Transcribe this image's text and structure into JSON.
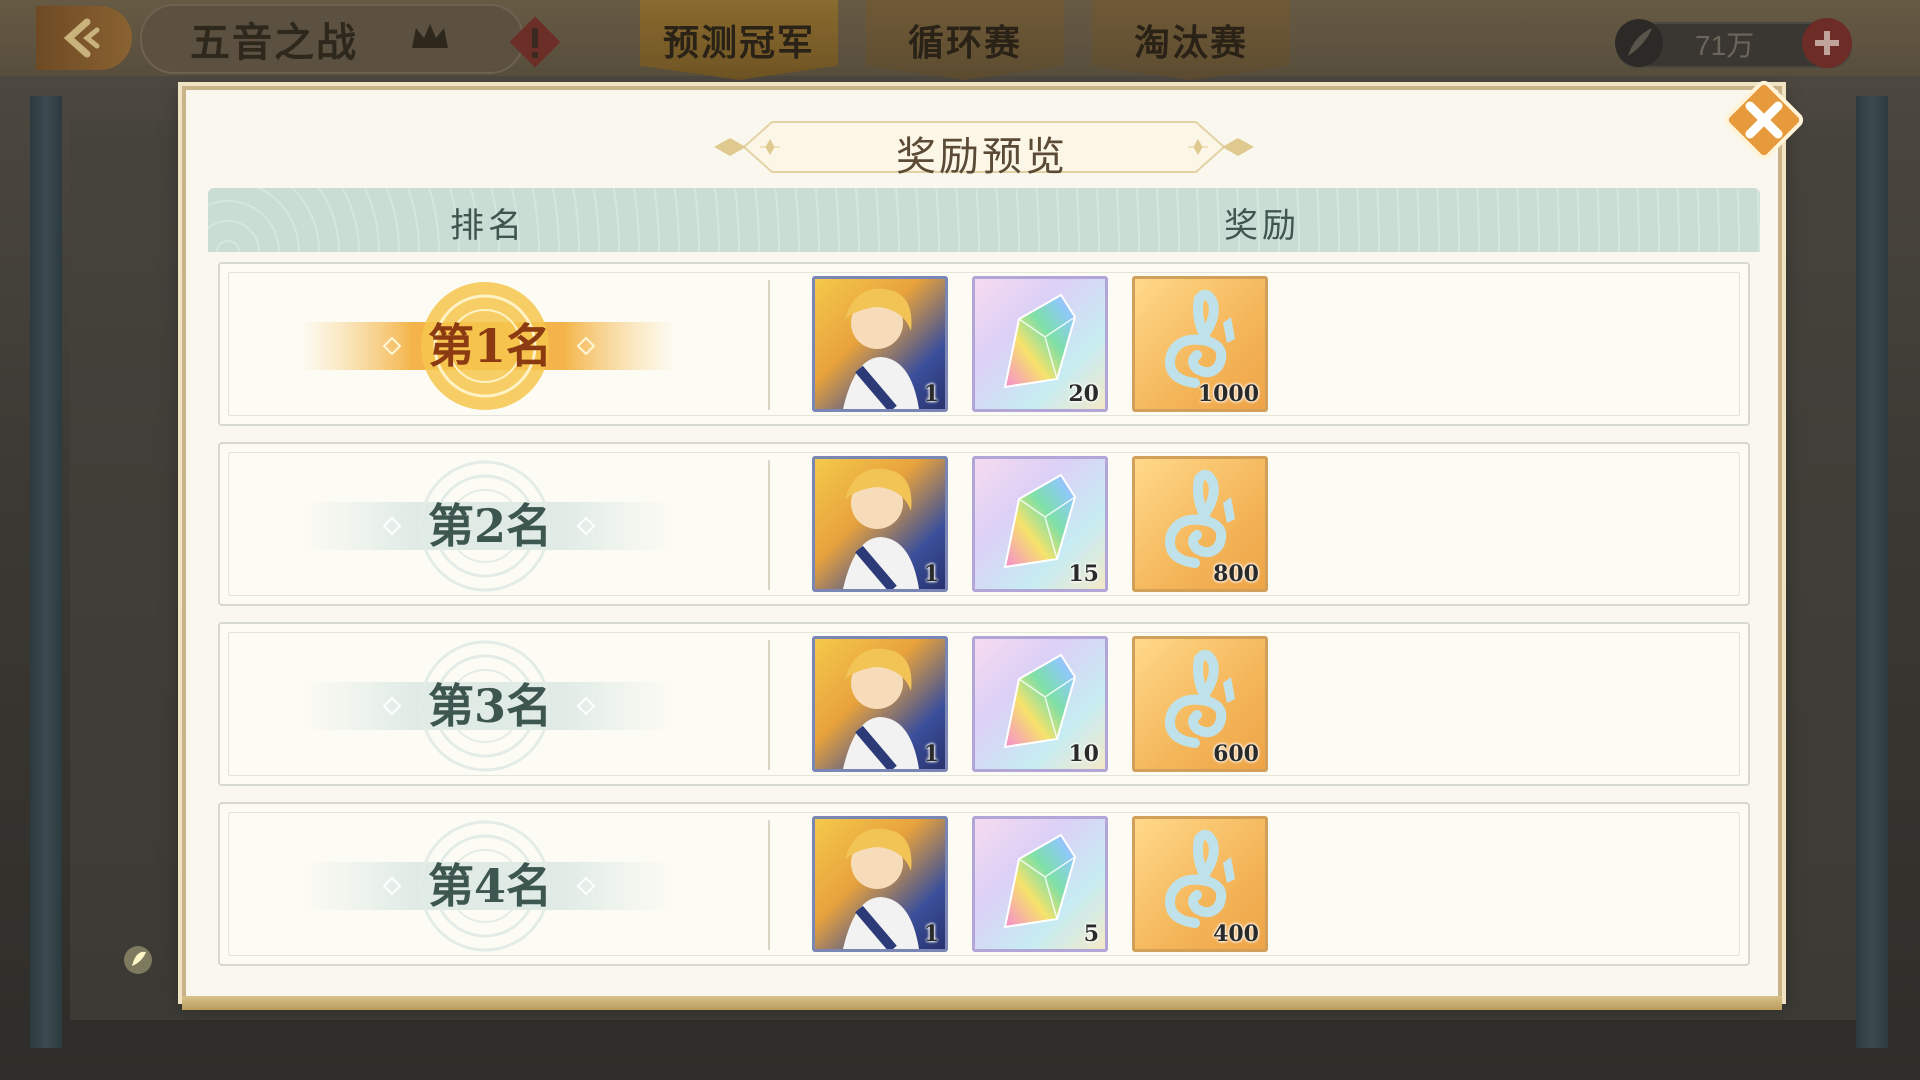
{
  "header": {
    "game_title": "五音之战",
    "tabs": [
      {
        "label": "预测冠军"
      },
      {
        "label": "循环赛"
      },
      {
        "label": "淘汰赛"
      }
    ],
    "currency_value": "71万"
  },
  "modal": {
    "title": "奖励预览",
    "columns": {
      "rank": "排名",
      "reward": "奖励"
    },
    "rows": [
      {
        "rank": "第1名",
        "rewards": [
          {
            "type": "character-card",
            "qty": "1"
          },
          {
            "type": "rainbow-crystal",
            "qty": "20"
          },
          {
            "type": "music-note-token",
            "qty": "1000"
          }
        ]
      },
      {
        "rank": "第2名",
        "rewards": [
          {
            "type": "character-card",
            "qty": "1"
          },
          {
            "type": "rainbow-crystal",
            "qty": "15"
          },
          {
            "type": "music-note-token",
            "qty": "800"
          }
        ]
      },
      {
        "rank": "第3名",
        "rewards": [
          {
            "type": "character-card",
            "qty": "1"
          },
          {
            "type": "rainbow-crystal",
            "qty": "10"
          },
          {
            "type": "music-note-token",
            "qty": "600"
          }
        ]
      },
      {
        "rank": "第4名",
        "rewards": [
          {
            "type": "character-card",
            "qty": "1"
          },
          {
            "type": "rainbow-crystal",
            "qty": "5"
          },
          {
            "type": "music-note-token",
            "qty": "400"
          }
        ]
      }
    ]
  },
  "colors": {
    "accent_gold": "#e8a23d",
    "header_teal": "#c9ddd4",
    "close_orange": "#e79a3c"
  }
}
